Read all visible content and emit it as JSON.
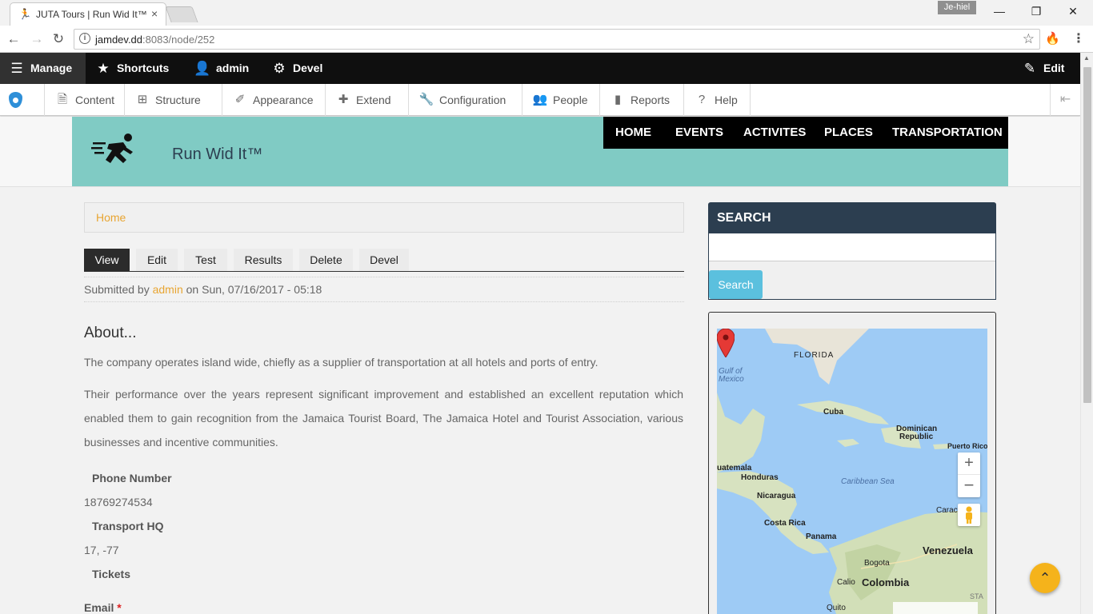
{
  "browser": {
    "tab_title": "JUTA Tours | Run Wid It™",
    "tab_close": "×",
    "profile_name": "Je-hiel",
    "url_host": "jamdev.dd",
    "url_rest": ":8083/node/252",
    "win_minimize": "—",
    "win_restore": "❐",
    "win_close": "✕",
    "icons": [
      "back-icon",
      "forward-icon",
      "reload-icon",
      "info-icon",
      "star-icon",
      "menu-icon"
    ]
  },
  "admin_toolbar": {
    "manage": "Manage",
    "shortcuts": "Shortcuts",
    "user": "admin",
    "devel": "Devel",
    "edit": "Edit"
  },
  "tray": {
    "items": [
      "Content",
      "Structure",
      "Appearance",
      "Extend",
      "Configuration",
      "People",
      "Reports",
      "Help"
    ]
  },
  "site": {
    "name": "Run Wid It™",
    "nav": [
      "HOME",
      "EVENTS",
      "ACTIVITES",
      "PLACES",
      "TRANSPORTATION"
    ]
  },
  "breadcrumb": {
    "home": "Home"
  },
  "local_tabs": [
    "View",
    "Edit",
    "Test",
    "Results",
    "Delete",
    "Devel"
  ],
  "submitted": {
    "prefix": "Submitted by",
    "author": "admin",
    "suffix": "on Sun, 07/16/2017 - 05:18"
  },
  "content": {
    "title": "About...",
    "para1": "The company operates island wide, chiefly as a supplier of transportation at all hotels and ports of entry.",
    "para2": "Their performance over the years represent significant improvement and established an excellent reputation which enabled them to gain recognition from the Jamaica Tourist Board, The Jamaica Hotel and Tourist Association, various businesses and incentive communities.",
    "phone_label": "Phone Number",
    "phone_value": "18769274534",
    "hq_label": "Transport HQ",
    "hq_value": "17, -77",
    "tickets_label": "Tickets",
    "email_label": "Email",
    "email_required": "*"
  },
  "search": {
    "title": "SEARCH",
    "button": "Search",
    "placeholder": ""
  },
  "map": {
    "labels": {
      "florida": "FLORIDA",
      "gulf1": "Gulf of",
      "gulf2": "Mexico",
      "cuba": "Cuba",
      "dominican1": "Dominican",
      "dominican2": "Republic",
      "puerto_rico": "Puerto Rico",
      "guatemala": "uatemala",
      "honduras": "Honduras",
      "caribbean": "Caribbean Sea",
      "nicaragua": "Nicaragua",
      "caracas": "Caracas",
      "costa_rica": "Costa Rica",
      "panama": "Panama",
      "venezuela": "Venezuela",
      "bogota": "Bogota",
      "calio": "Calio",
      "colombia": "Colombia",
      "quito": "Quito",
      "sta": "STA"
    },
    "zoom_in": "+",
    "zoom_out": "−"
  },
  "colors": {
    "header_teal": "#80cbc4",
    "link_orange": "#e8a532",
    "search_head": "#2c3e50",
    "search_button": "#5bc0de",
    "back_to_top": "#f5b31b"
  }
}
